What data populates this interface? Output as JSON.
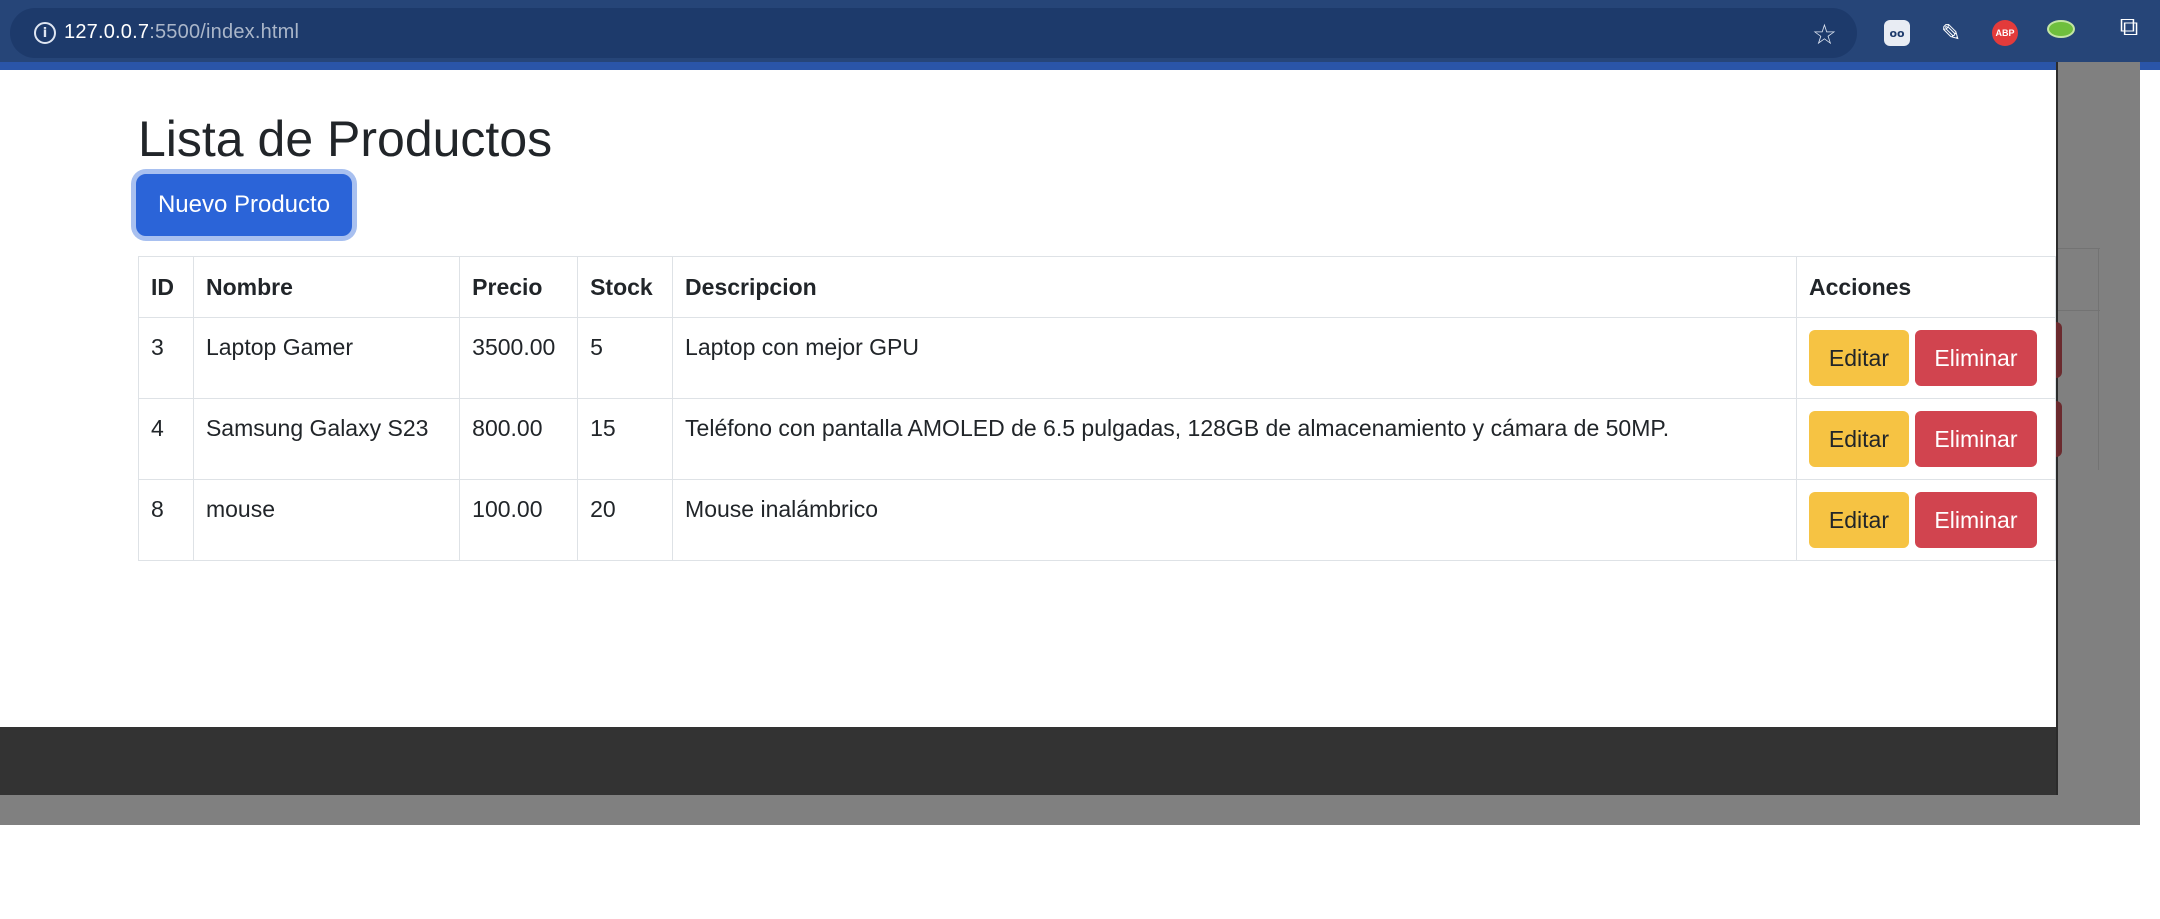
{
  "browser": {
    "url_host": "127.0.0.7",
    "url_path": ":5500/index.html",
    "ext_abp_label": "ABP"
  },
  "page": {
    "title": "Lista de Productos",
    "new_button_label": "Nuevo Producto"
  },
  "table": {
    "headers": [
      "ID",
      "Nombre",
      "Precio",
      "Stock",
      "Descripcion",
      "Acciones"
    ],
    "rows": [
      {
        "id": "3",
        "nombre": "Laptop Gamer",
        "precio": "3500.00",
        "stock": "5",
        "descripcion": "Laptop con mejor GPU"
      },
      {
        "id": "4",
        "nombre": "Samsung Galaxy S23",
        "precio": "800.00",
        "stock": "15",
        "descripcion": "Teléfono con pantalla AMOLED de 6.5 pulgadas, 128GB de almacenamiento y cámara de 50MP."
      },
      {
        "id": "8",
        "nombre": "mouse",
        "precio": "100.00",
        "stock": "20",
        "descripcion": "Mouse inalámbrico"
      }
    ],
    "edit_label": "Editar",
    "delete_label": "Eliminar"
  },
  "colors": {
    "primary": "#2b64d8",
    "warning": "#f6c343",
    "danger": "#d1444f",
    "footer": "#333333",
    "chrome": "#264578"
  }
}
